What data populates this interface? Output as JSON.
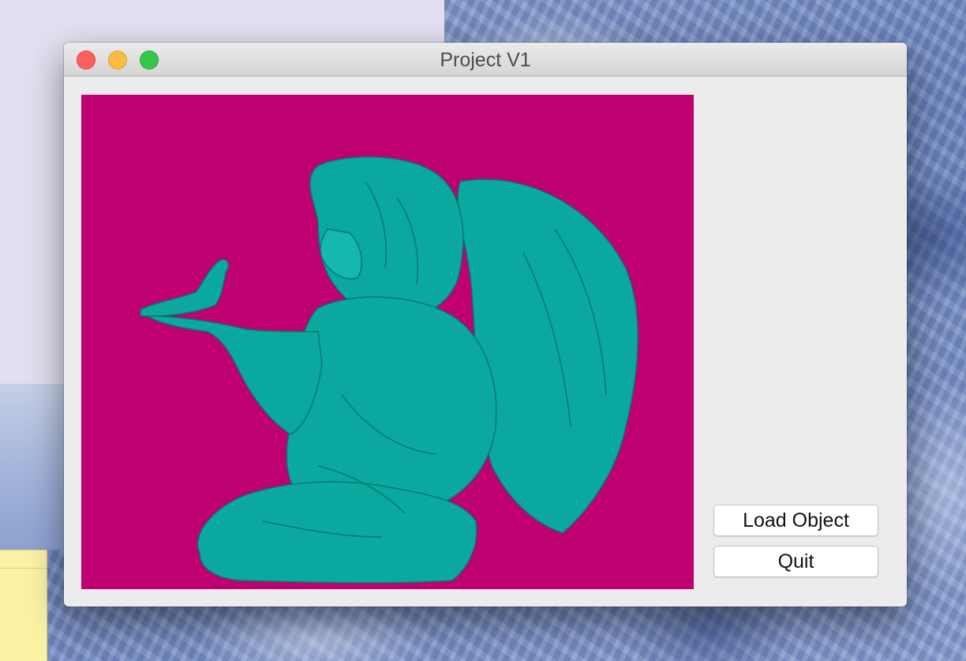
{
  "window": {
    "title": "Project V1",
    "controls": {
      "close": "close-button",
      "minimize": "minimize-button",
      "zoom": "zoom-button"
    }
  },
  "viewport": {
    "background_color": "#be0070",
    "model_color": "#0aa89f",
    "model_subject": "angel statue holding a bird"
  },
  "buttons": {
    "load_label": "Load Object",
    "quit_label": "Quit"
  }
}
